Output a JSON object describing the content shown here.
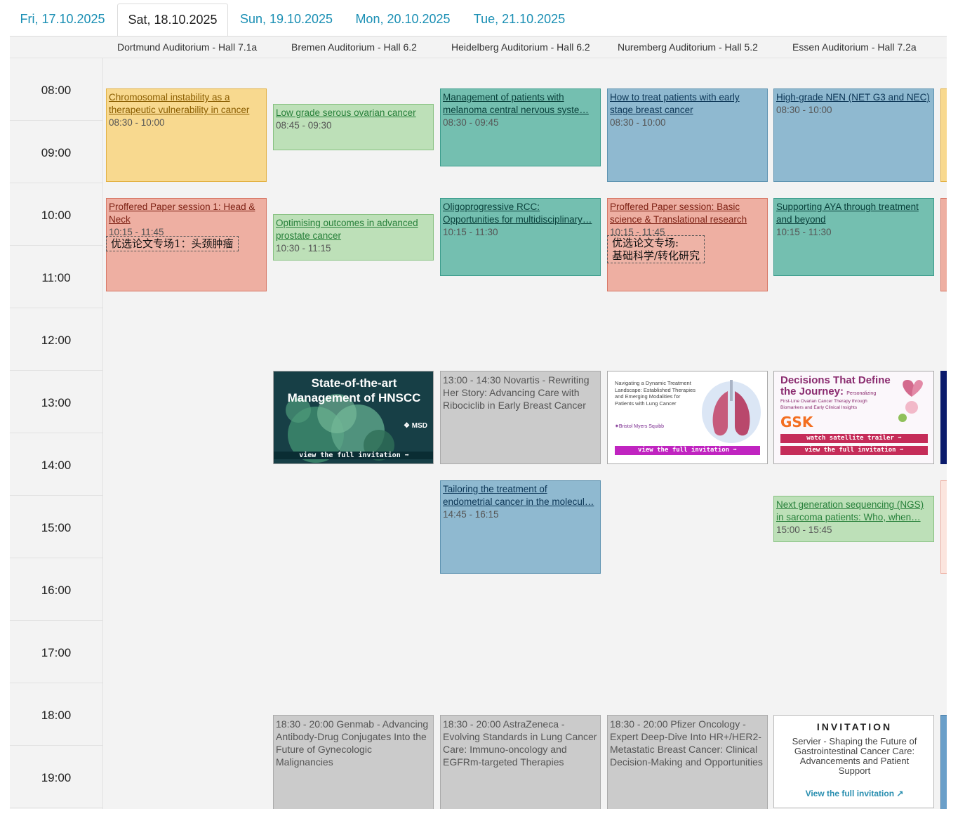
{
  "tabs": [
    {
      "label": "Fri, 17.10.2025"
    },
    {
      "label": "Sat, 18.10.2025"
    },
    {
      "label": "Sun, 19.10.2025"
    },
    {
      "label": "Mon, 20.10.2025"
    },
    {
      "label": "Tue, 21.10.2025"
    }
  ],
  "rooms": [
    "Dortmund Auditorium - Hall 7.1a",
    "Bremen Auditorium - Hall 6.2",
    "Heidelberg Auditorium - Hall 6.2",
    "Nuremberg Auditorium - Hall 5.2",
    "Essen Auditorium - Hall 7.2a"
  ],
  "times": [
    "08:00",
    "09:00",
    "10:00",
    "11:00",
    "12:00",
    "13:00",
    "14:00",
    "15:00",
    "16:00",
    "17:00",
    "18:00",
    "19:00"
  ],
  "sessions": {
    "chromosomal": {
      "title": "Chromosomal instability as a therapeutic vulnerability in cancer",
      "time": "08:30 - 10:00"
    },
    "ovarian": {
      "title": "Low grade serous ovarian cancer",
      "time": "08:45 - 09:30"
    },
    "melanoma": {
      "title": "Management of patients with melanoma central nervous syste…",
      "time": "08:30 - 09:45"
    },
    "breast_early": {
      "title": "How to treat patients with early stage breast cancer",
      "time": "08:30 - 10:00"
    },
    "nen": {
      "title": "High-grade NEN (NET G3 and NEC)",
      "time": "08:30 - 10:00"
    },
    "pp_headneck": {
      "title": "Proffered Paper session 1: Head & Neck",
      "time": "10:15 - 11:45",
      "note": "优选论文专场1：头颈肿瘤"
    },
    "optimising": {
      "title": "Optimising outcomes in advanced prostate cancer",
      "time": "10:30 - 11:15"
    },
    "rcc": {
      "title": "Oligoprogressive RCC: Opportunities for multidisciplinary…",
      "time": "10:15 - 11:30"
    },
    "pp_basic": {
      "title": "Proffered Paper session: Basic science & Translational research",
      "time": "10:15 - 11:45",
      "note_line1": "优选论文专场:",
      "note_line2": "基础科学/转化研究"
    },
    "aya": {
      "title": "Supporting AYA through treatment and beyond",
      "time": "10:15 - 11:30"
    },
    "novartis": {
      "text": "13:00 - 14:30 Novartis - Rewriting Her Story: Advancing Care with Ribociclib in Early Breast Cancer"
    },
    "endometrial": {
      "title": "Tailoring the treatment of endometrial cancer in the molecul…",
      "time": "14:45 - 16:15"
    },
    "ngs": {
      "title": "Next generation sequencing (NGS) in sarcoma patients: Who, when…",
      "time": "15:00 - 15:45"
    },
    "genmab": {
      "text": "18:30 - 20:00  Genmab - Advancing Antibody-Drug Conjugates Into the Future of Gynecologic Malignancies"
    },
    "astrazeneca": {
      "text": "18:30 - 20:00  AstraZeneca - Evolving Standards in Lung Cancer Care: Immuno-oncology and EGFRm-targeted Therapies"
    },
    "pfizer": {
      "text": "18:30 - 20:00  Pfizer Oncology - Expert Deep-Dive Into HR+/HER2- Metastatic Breast Cancer: Clinical Decision-Making and Opportunities"
    }
  },
  "ads": {
    "msd": {
      "title_line1": "State-of-the-art",
      "title_line2": "Management of HNSCC",
      "brand": "MSD",
      "button": "view the full invitation"
    },
    "bms": {
      "line1": "Navigating a Dynamic Treatment",
      "line2": "Landscape: Established Therapies",
      "line3": "and Emerging Modalities for",
      "line4": "Patients with Lung Cancer",
      "brand": "Bristol Myers Squibb",
      "button": "view the full invitation"
    },
    "gsk": {
      "title_line1": "Decisions That Define",
      "title_line2": "the Journey:",
      "subtitle_a": "Personalizing",
      "subtitle_b": "First-Line Ovarian Cancer Therapy through",
      "subtitle_c": "Biomarkers and Early Clinical Insights",
      "brand": "GSK",
      "button1": "watch satellite trailer",
      "button2": "view the full invitation"
    },
    "servier": {
      "heading": "INVITATION",
      "body": "Servier - Shaping the Future of Gastrointestinal Cancer Care: Advancements and Patient Support",
      "link": "View the full invitation"
    }
  },
  "colors": {
    "tab_text": "#1a8fb4",
    "yellow": "#f8d98f",
    "green": "#bde0b8",
    "teal": "#74bfb0",
    "blue": "#8fb9d0",
    "salmon": "#eeafa2",
    "gray": "#cbcbcb"
  },
  "icons": {
    "external_link": "external-link-icon",
    "arrow": "arrow-right-icon"
  }
}
